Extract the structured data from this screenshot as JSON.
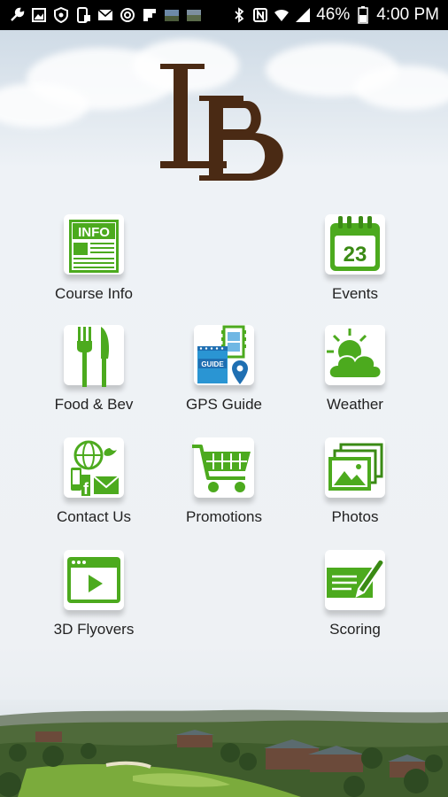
{
  "status_bar": {
    "battery_percent": "46%",
    "time": "4:00 PM",
    "left_icons": [
      "wrench-icon",
      "image-icon",
      "shield-icon",
      "phone-icon",
      "mail-icon",
      "at-icon",
      "flipboard-icon",
      "photo-icon",
      "photo-icon"
    ],
    "right_icons": [
      "bluetooth-icon",
      "nfc-icon",
      "wifi-icon",
      "signal-icon",
      "battery-icon"
    ]
  },
  "logo": {
    "text": "LB",
    "color": "#4a2a14"
  },
  "menu": [
    {
      "id": "course-info",
      "label": "Course Info",
      "icon": "info-newspaper-icon"
    },
    {
      "id": "events",
      "label": "Events",
      "icon": "calendar-icon",
      "calendar_day": "23"
    },
    {
      "id": "food-bev",
      "label": "Food & Bev",
      "icon": "fork-knife-icon"
    },
    {
      "id": "gps-guide",
      "label": "GPS Guide",
      "icon": "gps-guide-icon",
      "guide_text": "GUIDE"
    },
    {
      "id": "weather",
      "label": "Weather",
      "icon": "sun-cloud-icon"
    },
    {
      "id": "contact-us",
      "label": "Contact Us",
      "icon": "contact-icon"
    },
    {
      "id": "promotions",
      "label": "Promotions",
      "icon": "cart-icon"
    },
    {
      "id": "photos",
      "label": "Photos",
      "icon": "photos-icon"
    },
    {
      "id": "3d-flyovers",
      "label": "3D Flyovers",
      "icon": "video-icon"
    },
    {
      "id": "scoring",
      "label": "Scoring",
      "icon": "scorecard-pencil-icon"
    }
  ],
  "colors": {
    "accent_green": "#4caa1e",
    "dark_green": "#3a8a14",
    "blue": "#1f6fb2",
    "status_bar": "#000000"
  }
}
